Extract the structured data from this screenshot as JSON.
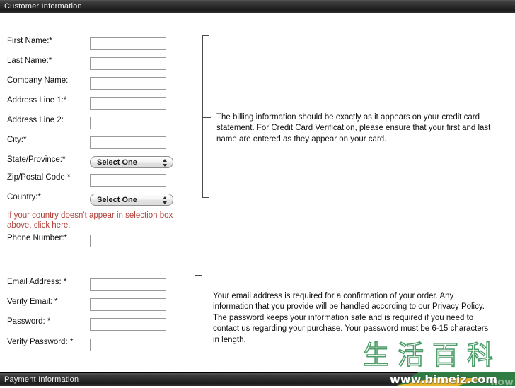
{
  "sections": {
    "customer": {
      "title": "Customer Information"
    },
    "payment": {
      "title": "Payment Information"
    }
  },
  "billing_form": {
    "fields": [
      {
        "label": "First Name:*",
        "type": "text",
        "value": "",
        "placeholder": ""
      },
      {
        "label": "Last Name:*",
        "type": "text",
        "value": "",
        "placeholder": ""
      },
      {
        "label": "Company Name:",
        "type": "text",
        "value": "",
        "placeholder": ""
      },
      {
        "label": "Address Line 1:*",
        "type": "text",
        "value": "",
        "placeholder": ""
      },
      {
        "label": "Address Line 2:",
        "type": "text",
        "value": "",
        "placeholder": ""
      },
      {
        "label": "City:*",
        "type": "text",
        "value": "",
        "placeholder": ""
      },
      {
        "label": "State/Province:*",
        "type": "select",
        "value": "Select One"
      },
      {
        "label": "Zip/Postal Code:*",
        "type": "text",
        "value": "",
        "placeholder": ""
      },
      {
        "label": "Country:*",
        "type": "select",
        "value": "Select One"
      },
      {
        "label": "Phone Number:*",
        "type": "text",
        "value": "",
        "placeholder": ""
      }
    ],
    "country_note": {
      "line1": "If your country doesn't appear in selection box above,",
      "line2": "click here."
    },
    "info": "The billing information should be exactly as it appears on your credit card statement. For Credit Card Verification, please ensure that your first and last name are entered as they appear on your card."
  },
  "account_form": {
    "fields": [
      {
        "label": "Email Address:  *",
        "type": "text",
        "value": "",
        "placeholder": ""
      },
      {
        "label": "Verify Email:   *",
        "type": "text",
        "value": "",
        "placeholder": ""
      },
      {
        "label": "Password:   *",
        "type": "text",
        "value": "",
        "placeholder": ""
      },
      {
        "label": "Verify Password:   *",
        "type": "text",
        "value": "",
        "placeholder": ""
      }
    ],
    "info": "Your email address is required for a confirmation of your order. Any information that you provide will be handled according to our Privacy Policy. The password keeps your information safe and is required if you need to contact us regarding your purchase. Your password must be 6-15 characters in length."
  },
  "watermark": {
    "cjk": "生活百科",
    "url": "www.bimeiz.com",
    "ghost": "how"
  },
  "colors": {
    "header_bar": "#2b2b2b",
    "note_red": "#b0413a",
    "ribbon_green": "#2f7d42",
    "ribbon_gold": "#e8b62c"
  }
}
